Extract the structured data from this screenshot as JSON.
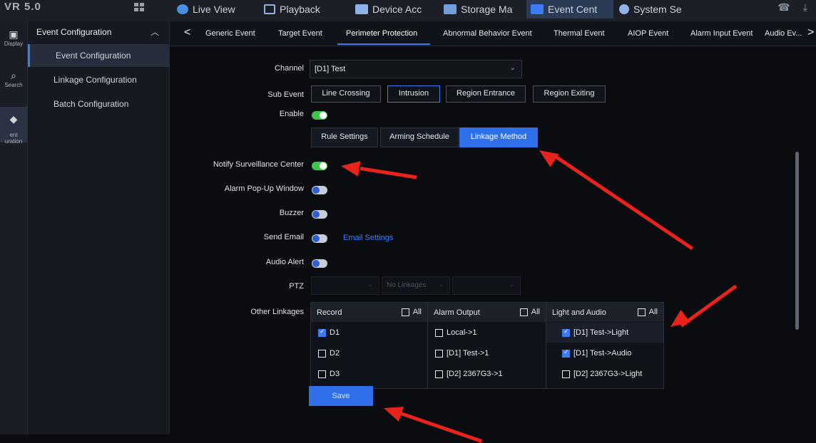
{
  "top": {
    "brand": "VR 5.0",
    "nav": [
      {
        "label": "Live View",
        "icon": "live-view-icon",
        "active": false
      },
      {
        "label": "Playback",
        "icon": "playback-icon",
        "active": false
      },
      {
        "label": "Device Acc",
        "icon": "device-access-icon",
        "active": false
      },
      {
        "label": "Storage Ma",
        "icon": "storage-icon",
        "active": false
      },
      {
        "label": "Event Cent",
        "icon": "event-center-icon",
        "active": true
      },
      {
        "label": "System Se",
        "icon": "gear-icon",
        "active": false
      }
    ]
  },
  "rail": {
    "items": [
      {
        "label": "Display"
      },
      {
        "label": "Search"
      },
      {
        "label": "ent\nuration"
      }
    ]
  },
  "sidebar": {
    "header": "Event Configuration",
    "items": [
      {
        "label": "Event Configuration",
        "active": true
      },
      {
        "label": "Linkage Configuration",
        "active": false
      },
      {
        "label": "Batch Configuration",
        "active": false
      }
    ]
  },
  "subtabs": {
    "back": "<",
    "items": [
      "Generic Event",
      "Target Event",
      "Perimeter Protection",
      "Abnormal Behavior Event",
      "Thermal Event",
      "AIOP Event",
      "Alarm Input Event",
      "Audio Ev..."
    ],
    "active": "Perimeter Protection",
    "more": ">"
  },
  "form": {
    "channel_label": "Channel",
    "channel_value": "[D1] Test",
    "sub_event_label": "Sub Event",
    "sub_events": [
      "Line Crossing",
      "Intrusion",
      "Region Entrance",
      "Region Exiting"
    ],
    "sub_event_selected": "Intrusion",
    "enable_label": "Enable",
    "enable_on": true,
    "config_tabs": [
      "Rule Settings",
      "Arming Schedule",
      "Linkage Method"
    ],
    "config_tab_active": "Linkage Method",
    "notify_label": "Notify Surveillance Center",
    "notify_on": true,
    "popup_label": "Alarm Pop-Up Window",
    "popup_on": false,
    "buzzer_label": "Buzzer",
    "buzzer_on": false,
    "email_label": "Send Email",
    "email_on": false,
    "email_settings": "Email Settings",
    "audio_label": "Audio Alert",
    "audio_on": false,
    "ptz_label": "PTZ",
    "ptz_middle": "No Linkages",
    "other_label": "Other Linkages",
    "save": "Save"
  },
  "linkages": {
    "record": {
      "title": "Record",
      "all": "All",
      "items": [
        {
          "label": "D1",
          "checked": true
        },
        {
          "label": "D2",
          "checked": false
        },
        {
          "label": "D3",
          "checked": false
        }
      ]
    },
    "alarm_output": {
      "title": "Alarm Output",
      "all": "All",
      "items": [
        {
          "label": "Local->1",
          "checked": false
        },
        {
          "label": "[D1] Test->1",
          "checked": false
        },
        {
          "label": "[D2] 2367G3->1",
          "checked": false
        }
      ]
    },
    "light_audio": {
      "title": "Light and Audio",
      "all": "All",
      "items": [
        {
          "label": "[D1] Test->Light",
          "checked": true
        },
        {
          "label": "[D1] Test->Audio",
          "checked": true
        },
        {
          "label": "[D2] 2367G3->Light",
          "checked": false
        }
      ]
    }
  },
  "colors": {
    "accent": "#2f6fe9",
    "toggle_on": "#3ec64a",
    "annotation_arrow": "#e8231b"
  }
}
